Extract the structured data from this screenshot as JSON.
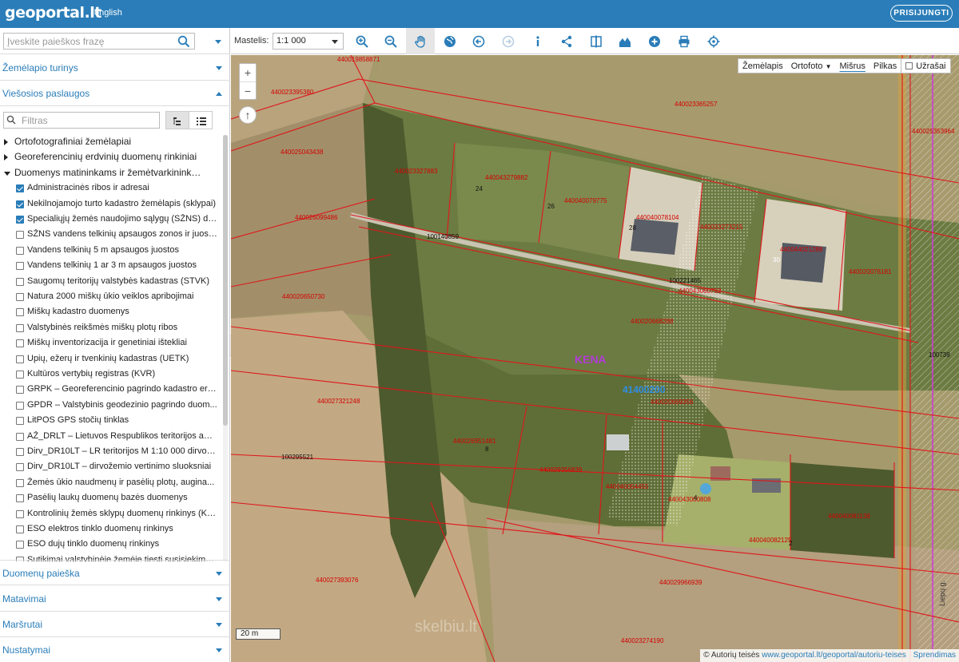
{
  "header": {
    "logo": "geoportal.lt",
    "language": "english",
    "login_label": "PRISIJUNGTI"
  },
  "sidebar": {
    "search_placeholder": "Įveskite paieškos frazę",
    "sections_top": [
      {
        "label": "Žemėlapio turinys"
      },
      {
        "label": "Viešosios paslaugos"
      }
    ],
    "filter_placeholder": "Filtras",
    "tree": [
      {
        "type": "group",
        "state": "collapsed",
        "label": "Ortofotografiniai žemėlapiai"
      },
      {
        "type": "group",
        "state": "collapsed",
        "label": "Georeferencinių erdvinių duomenų rinkiniai"
      },
      {
        "type": "group",
        "state": "expanded",
        "label": "Duomenys matininkams ir žemėtvarkininkams"
      },
      {
        "type": "item",
        "checked": true,
        "label": "Administracinės ribos ir adresai"
      },
      {
        "type": "item",
        "checked": true,
        "label": "Nekilnojamojo turto kadastro žemėlapis (sklypai)"
      },
      {
        "type": "item",
        "checked": true,
        "label": "Specialiųjų žemės naudojimo sąlygų (SŽNS) du..."
      },
      {
        "type": "item",
        "checked": false,
        "label": "SŽNS vandens telkinių apsaugos zonos ir juostos"
      },
      {
        "type": "item",
        "checked": false,
        "label": "Vandens telkinių 5 m apsaugos juostos"
      },
      {
        "type": "item",
        "checked": false,
        "label": "Vandens telkinių 1 ar 3 m apsaugos juostos"
      },
      {
        "type": "item",
        "checked": false,
        "label": "Saugomų teritorijų valstybės kadastras (STVK)"
      },
      {
        "type": "item",
        "checked": false,
        "label": "Natura 2000 miškų ūkio veiklos apribojimai"
      },
      {
        "type": "item",
        "checked": false,
        "label": "Miškų kadastro duomenys"
      },
      {
        "type": "item",
        "checked": false,
        "label": "Valstybinės reikšmės miškų plotų ribos"
      },
      {
        "type": "item",
        "checked": false,
        "label": "Miškų inventorizacija ir genetiniai ištekliai"
      },
      {
        "type": "item",
        "checked": false,
        "label": "Upių, ežerų ir tvenkinių kadastras (UETK)"
      },
      {
        "type": "item",
        "checked": false,
        "label": "Kultūros vertybių registras (KVR)"
      },
      {
        "type": "item",
        "checked": false,
        "label": "GRPK – Georeferencinio pagrindo kadastro erd..."
      },
      {
        "type": "item",
        "checked": false,
        "label": "GPDR – Valstybinis geodezinio pagrindo duom..."
      },
      {
        "type": "item",
        "checked": false,
        "label": "LitPOS GPS stočių tinklas"
      },
      {
        "type": "item",
        "checked": false,
        "label": "AŽ_DRLT – Lietuvos Respublikos teritorijos apl..."
      },
      {
        "type": "item",
        "checked": false,
        "label": "Dirv_DR10LT – LR teritorijos M 1:10 000 dirvož..."
      },
      {
        "type": "item",
        "checked": false,
        "label": "Dirv_DR10LT – dirvožemio vertinimo sluoksniai"
      },
      {
        "type": "item",
        "checked": false,
        "label": "Žemės ūkio naudmenų ir pasėlių plotų, augina..."
      },
      {
        "type": "item",
        "checked": false,
        "label": "Pasėlių laukų duomenų bazės duomenys"
      },
      {
        "type": "item",
        "checked": false,
        "label": "Kontrolinių žemės sklypų duomenų rinkinys (KŽ..."
      },
      {
        "type": "item",
        "checked": false,
        "label": "ESO elektros tinklo duomenų rinkinys"
      },
      {
        "type": "item",
        "checked": false,
        "label": "ESO dujų tinklo duomenų rinkinys"
      },
      {
        "type": "item",
        "checked": false,
        "label": "Sutikimai valstybinėje žemėje tiesti susisiekimo..."
      }
    ],
    "sections_bottom": [
      {
        "label": "Duomenų paieška"
      },
      {
        "label": "Matavimai"
      },
      {
        "label": "Maršrutai"
      },
      {
        "label": "Nustatymai"
      }
    ]
  },
  "toolbar": {
    "scale_label": "Mastelis:",
    "scale_value": "1:1 000",
    "tools": [
      "zoom-in-icon",
      "zoom-out-icon",
      "pan-hand-icon",
      "globe-icon",
      "back-arrow-icon",
      "forward-arrow-icon",
      "info-icon",
      "share-icon",
      "compare-icon",
      "profile-chart-icon",
      "add-circle-icon",
      "print-icon",
      "locate-crosshair-icon"
    ]
  },
  "map": {
    "zoom_in": "+",
    "zoom_out": "−",
    "north": "↑",
    "basemaps": [
      "Žemėlapis",
      "Ortofoto",
      "Mišrus",
      "Pilkas"
    ],
    "selected_basemap": "Mišrus",
    "labels_toggle": "Užrašai",
    "scale_text": "20 m",
    "attribution_prefix": "© Autorių teisės",
    "attribution_link": "www.geoportal.lt/geoportal/autoriu-teises",
    "attribution_suffix": "Sprendimas",
    "watermark": "skelbiu.lt",
    "parcel_ids": [
      "440019858871",
      "440023395380",
      "440023365257",
      "440025353964",
      "440025043438",
      "440023327883",
      "440043279882",
      "440040079775",
      "440040078104",
      "440033273215",
      "440044021288",
      "440020076181",
      "440026099486",
      "100140859",
      "100221465",
      "440043060752",
      "440020650730",
      "440020668288",
      "100739",
      "440027321248",
      "41400200",
      "440020669356",
      "440026951481",
      "100295521",
      "440029356839",
      "440040054455",
      "440043000808",
      "440040082125",
      "440040081138",
      "440029966939",
      "440027393076",
      "440023274190"
    ],
    "house_numbers": [
      "24",
      "26",
      "28",
      "30",
      "8",
      "4",
      "2"
    ],
    "place_name": "KENA",
    "street_label": "Liepų g."
  },
  "colors": {
    "header_bg": "#2a7db8",
    "accent": "#2a7db8",
    "parcel_line": "#e0161b",
    "place_name": "#b23bd6",
    "parcel_highlight": "#2f8fe6"
  }
}
